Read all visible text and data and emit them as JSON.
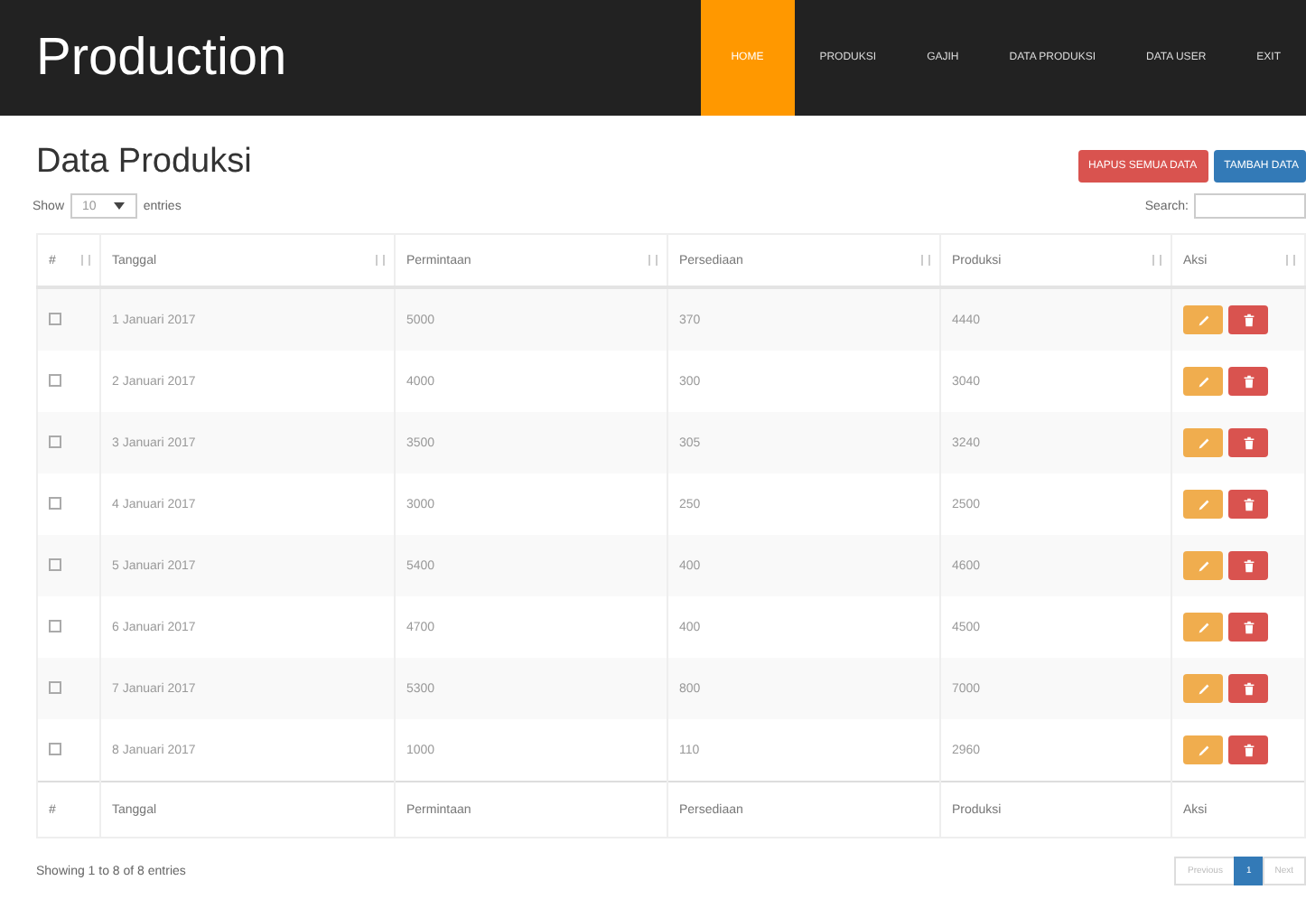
{
  "navbar": {
    "brand": "Production",
    "items": [
      {
        "label": "HOME",
        "selected": true
      },
      {
        "label": "PRODUKSI",
        "selected": false
      },
      {
        "label": "GAJIH",
        "selected": false
      },
      {
        "label": "DATA PRODUKSI",
        "selected": false
      },
      {
        "label": "DATA USER",
        "selected": false
      },
      {
        "label": "EXIT",
        "selected": false
      }
    ]
  },
  "page_title": "Data Produksi",
  "buttons": [
    {
      "label": "HAPUS SEMUA DATA",
      "kind": "danger"
    },
    {
      "label": "TAMBAH DATA",
      "kind": "primary"
    }
  ],
  "length_control": {
    "before": "Show",
    "value": "10",
    "after": "entries"
  },
  "search": {
    "label": "Search:"
  },
  "table": {
    "columns": [
      "#",
      "Tanggal",
      "Permintaan",
      "Persediaan",
      "Produksi",
      "Aksi"
    ],
    "rows": [
      {
        "checked": false,
        "cells": [
          "",
          "1 Januari 2017",
          "5000",
          "370",
          "4440",
          ""
        ]
      },
      {
        "checked": false,
        "cells": [
          "",
          "2 Januari 2017",
          "4000",
          "300",
          "3040",
          ""
        ]
      },
      {
        "checked": false,
        "cells": [
          "",
          "3 Januari 2017",
          "3500",
          "305",
          "3240",
          ""
        ]
      },
      {
        "checked": false,
        "cells": [
          "",
          "4 Januari 2017",
          "3000",
          "250",
          "2500",
          ""
        ]
      },
      {
        "checked": false,
        "cells": [
          "",
          "5 Januari 2017",
          "5400",
          "400",
          "4600",
          ""
        ]
      },
      {
        "checked": false,
        "cells": [
          "",
          "6 Januari 2017",
          "4700",
          "400",
          "4500",
          ""
        ]
      },
      {
        "checked": false,
        "cells": [
          "",
          "7 Januari 2017",
          "5300",
          "800",
          "7000",
          ""
        ]
      },
      {
        "checked": false,
        "cells": [
          "",
          "8 Januari 2017",
          "1000",
          "110",
          "2960",
          ""
        ]
      }
    ],
    "footer": [
      "#",
      "Tanggal",
      "Permintaan",
      "Persediaan",
      "Produksi",
      "Aksi"
    ]
  },
  "info": "Showing 1 to 8 of 8 entries",
  "pagination": [
    {
      "label": "Previous",
      "selected": false
    },
    {
      "label": "1",
      "selected": true
    },
    {
      "label": "Next",
      "selected": false
    }
  ]
}
